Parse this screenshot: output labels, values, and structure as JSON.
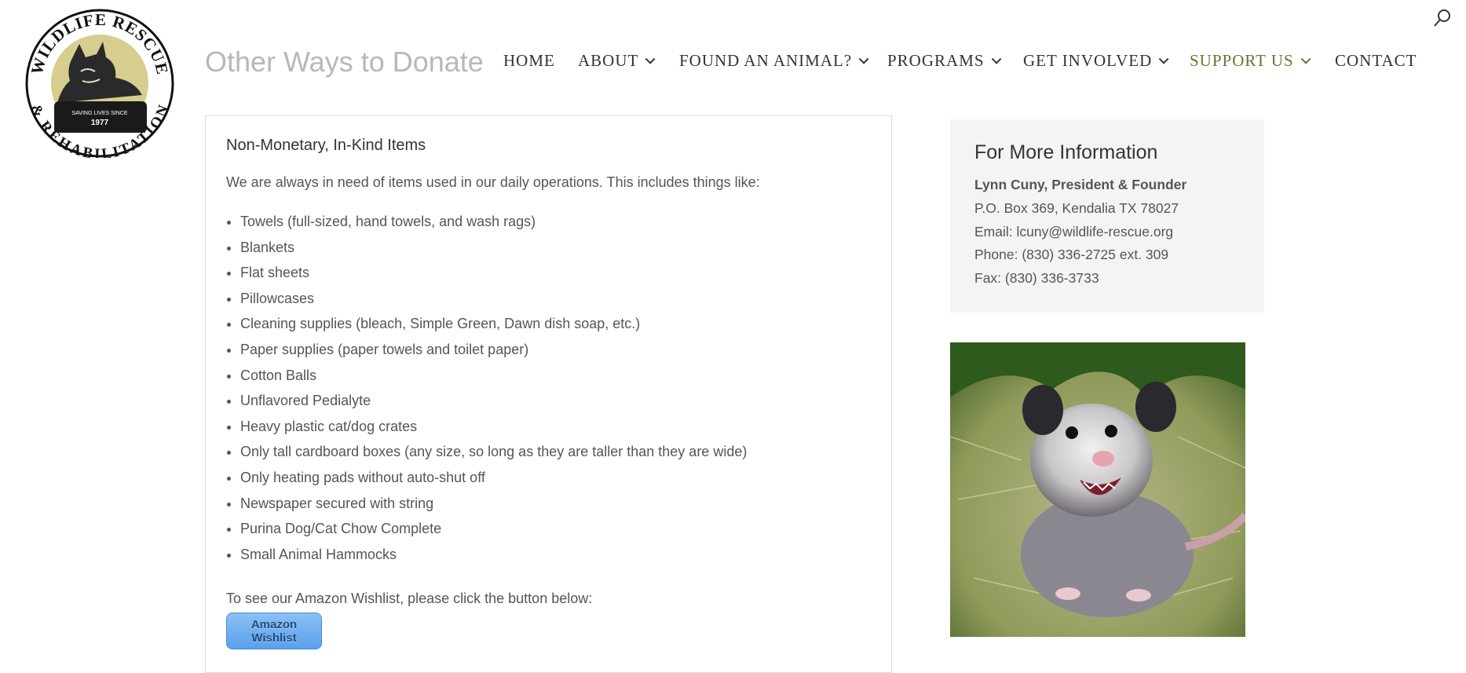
{
  "header": {
    "page_title": "Other Ways to Donate",
    "logo_top_text": "WILDLIFE RESCUE",
    "logo_bottom_text": "& REHABILITATION",
    "logo_tagline": "SAVING LIVES SINCE",
    "logo_year": "1977"
  },
  "nav": {
    "items": [
      {
        "label": "HOME",
        "dropdown": false,
        "active": false
      },
      {
        "label": "ABOUT",
        "dropdown": true,
        "active": false
      },
      {
        "label": "FOUND AN ANIMAL?",
        "dropdown": true,
        "active": false
      },
      {
        "label": "PROGRAMS",
        "dropdown": true,
        "active": false
      },
      {
        "label": "GET INVOLVED",
        "dropdown": true,
        "active": false
      },
      {
        "label": "SUPPORT US",
        "dropdown": true,
        "active": true
      },
      {
        "label": "CONTACT",
        "dropdown": false,
        "active": false
      }
    ],
    "active_color": "#5b7a28",
    "search_icon": "search-icon"
  },
  "main": {
    "heading": "Non-Monetary, In-Kind Items",
    "intro": "We are always in need of items used in our daily operations. This includes things like:",
    "items": [
      "Towels (full-sized, hand towels, and wash rags)",
      "Blankets",
      "Flat sheets",
      "Pillowcases",
      "Cleaning supplies (bleach, Simple Green, Dawn dish soap, etc.)",
      "Paper supplies (paper towels and toilet paper)",
      "Cotton Balls",
      "Unflavored Pedialyte",
      "Heavy plastic cat/dog crates",
      "Only tall cardboard boxes (any size, so long as they are taller than they are wide)",
      "Only heating pads without auto-shut off",
      "Newspaper secured with string",
      "Purina Dog/Cat Chow Complete",
      "Small Animal Hammocks"
    ],
    "wishlist_text": "To see our Amazon Wishlist, please click the button below:",
    "wishlist_button": "Amazon Wishlist"
  },
  "sidebar": {
    "heading": "For More Information",
    "name": "Lynn Cuny, President & Founder",
    "address": "P.O. Box 369, Kendalia TX 78027",
    "email": "Email: lcuny@wildlife-rescue.org",
    "phone": "Phone: (830) 336-2725 ext. 309",
    "fax": "Fax: (830) 336-3733"
  },
  "colors": {
    "logo_fill": "#d6cd8e",
    "button_blue": "#5aa0ec"
  }
}
